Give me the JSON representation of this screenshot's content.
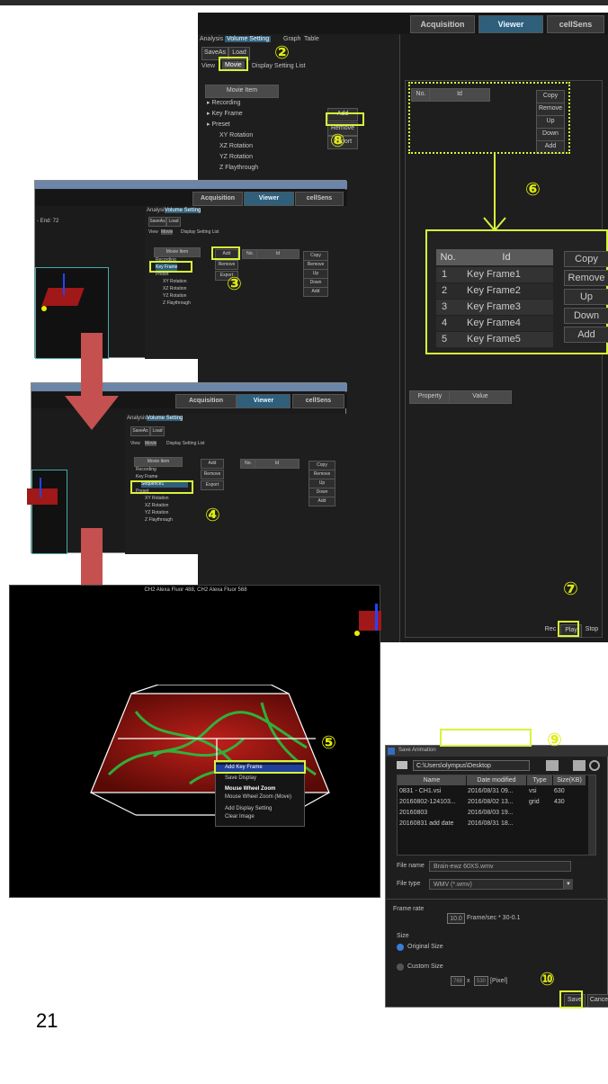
{
  "page_number": "21",
  "main_window": {
    "tabs": [
      "Acquisition",
      "Viewer",
      "cellSens"
    ],
    "panel_tabs": [
      "Analysis",
      "Volume Setting",
      "Graph",
      "Table"
    ],
    "file_buttons": [
      "SaveAs",
      "Load"
    ],
    "sub_tabs": [
      "View",
      "Movie",
      "Display Setting List"
    ],
    "movie_item_header": "Movie Item",
    "tree": [
      "Recording",
      "Key Frame",
      "Preset",
      "XY Rotation",
      "XZ Rotation",
      "YZ Rotation",
      "Z Flaythrough"
    ],
    "mid_buttons": [
      "Add",
      "Remove",
      "Export"
    ],
    "list_headers": [
      "No.",
      "Id"
    ],
    "right_buttons": [
      "Copy",
      "Remove",
      "Up",
      "Down",
      "Add"
    ],
    "property_headers": [
      "Property",
      "Value"
    ],
    "playback_buttons": [
      "Rec",
      "Play",
      "Stop"
    ]
  },
  "zoom_table": {
    "headers": [
      "No.",
      "Id"
    ],
    "rows": [
      {
        "no": "1",
        "id": "Key Frame1"
      },
      {
        "no": "2",
        "id": "Key Frame2"
      },
      {
        "no": "3",
        "id": "Key Frame3"
      },
      {
        "no": "4",
        "id": "Key Frame4"
      },
      {
        "no": "5",
        "id": "Key Frame5"
      }
    ],
    "buttons": [
      "Copy",
      "Remove",
      "Up",
      "Down",
      "Add"
    ]
  },
  "shot3": {
    "title_fragment": "- End: 72",
    "tabs": [
      "Acquisition",
      "Viewer",
      "cellSens"
    ],
    "panel_tabs": [
      "Analysis",
      "Volume Setting"
    ],
    "file_buttons": [
      "SaveAs",
      "Load"
    ],
    "sub_tabs": [
      "View",
      "Movie",
      "Display Setting List"
    ],
    "movie_item_header": "Movie Item",
    "tree": [
      "Recording",
      "Key Frame",
      "Preset",
      "XY Rotation",
      "XZ Rotation",
      "YZ Rotation",
      "Z Flaythrough"
    ],
    "mid_buttons": [
      "Add",
      "Remove",
      "Export"
    ],
    "list_headers": [
      "No.",
      "Id"
    ],
    "right_buttons": [
      "Copy",
      "Remove",
      "Up",
      "Down",
      "Add"
    ]
  },
  "shot4": {
    "tabs": [
      "Acquisition",
      "Viewer",
      "cellSens"
    ],
    "panel_tabs": [
      "Analysis",
      "Volume Setting"
    ],
    "file_buttons": [
      "SaveAs",
      "Load"
    ],
    "sub_tabs": [
      "View",
      "Movie",
      "Display Setting List"
    ],
    "movie_item_header": "Movie Item",
    "tree": [
      "Recording",
      "Key Frame",
      "Sequence1",
      "Preset",
      "XY Rotation",
      "XZ Rotation",
      "YZ Rotation",
      "Z Flaythrough"
    ],
    "mid_buttons": [
      "Add",
      "Remove",
      "Export"
    ],
    "list_headers": [
      "No.",
      "Id"
    ],
    "right_buttons": [
      "Copy",
      "Remove",
      "Up",
      "Down",
      "Add"
    ]
  },
  "viewer": {
    "title": "CH2 Alexa Fluor 488, CH2 Alexa Fluor 568",
    "context_menu": [
      "Add Key Frame",
      "Save Display",
      "Mouse Wheel Zoom",
      "Mouse Wheel Zoom (Move)",
      "Add Display Setting",
      "Clear Image"
    ]
  },
  "save_dialog": {
    "title": "Save Animation",
    "path": "C:\\Users\\olympus\\Desktop",
    "columns": [
      "Name",
      "Date modified",
      "Type",
      "Size(KB)"
    ],
    "files": [
      {
        "name": "0831 - CH1.vsi",
        "date": "2016/08/31 09...",
        "type": "vsi",
        "size": "630"
      },
      {
        "name": "20160802-124103...",
        "date": "2016/08/02 13...",
        "type": "grid",
        "size": "430"
      },
      {
        "name": "20160803",
        "date": "2016/08/03 19...",
        "type": "",
        "size": ""
      },
      {
        "name": "20160831 add date",
        "date": "2016/08/31 18...",
        "type": "",
        "size": ""
      }
    ],
    "file_name_label": "File name",
    "file_name_value": "Brain-ewz 60XS.wmv",
    "file_type_label": "File type",
    "file_type_value": "WMV (*.wmv)",
    "frame_rate_label": "Frame rate",
    "frame_rate_value": "10.0",
    "frame_rate_unit": "Frame/sec * 30-0.1",
    "size_label": "Size",
    "original_size": "Original Size",
    "custom_size": "Custom Size",
    "width": "768",
    "height": "530",
    "pixel_unit": "[Pixel]",
    "save_button": "Save",
    "cancel_button": "Cance"
  },
  "callouts": [
    "②",
    "③",
    "④",
    "⑤",
    "⑥",
    "⑦",
    "⑧",
    "⑨",
    "⑩"
  ],
  "colors": {
    "highlight": "#d9f33a",
    "arrow": "#c45050",
    "accent_tab": "#2f5f7a"
  }
}
